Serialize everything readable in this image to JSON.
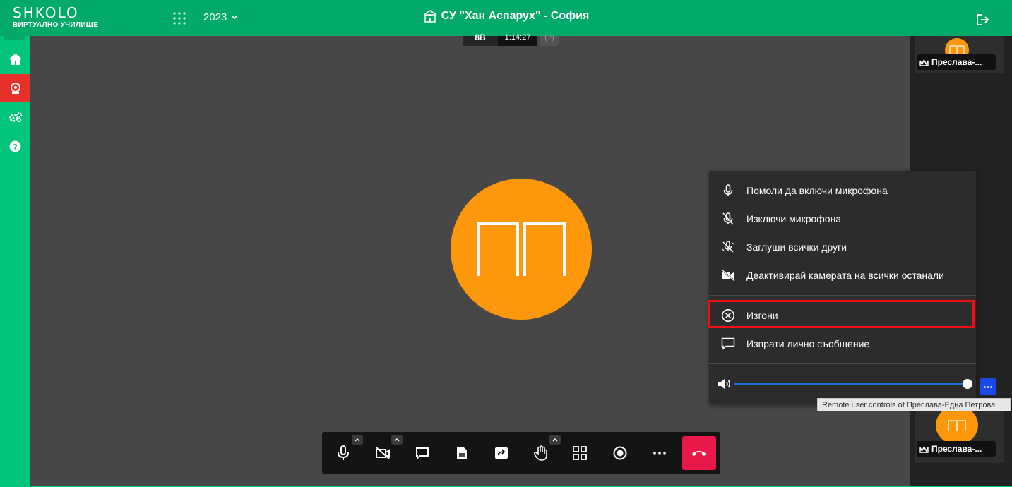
{
  "app": {
    "logo_word": "SHKOLO",
    "logo_sub": "ВИРТУАЛНО УЧИЛИЩЕ",
    "year": "2023",
    "school_name": "СУ \"Хан Аспарух\" - София"
  },
  "session": {
    "class_label": "8В",
    "timer": "1:14:27",
    "help_label": "(?)"
  },
  "main_avatar": {
    "initials": "ПП",
    "color": "#fd980d"
  },
  "participants": [
    {
      "name": "Преслава-...",
      "initials": "ПП"
    },
    {
      "name": "Преслава-...",
      "initials": "ПП"
    }
  ],
  "context_menu": {
    "items": [
      {
        "label": "Помоли да включи микрофона",
        "icon": "mic-icon"
      },
      {
        "label": "Изключи микрофона",
        "icon": "mic-off-icon"
      },
      {
        "label": "Заглуши всички други",
        "icon": "mute-all-icon"
      },
      {
        "label": "Деактивирай камерата на всички останали",
        "icon": "camera-off-all-icon"
      }
    ],
    "kick_label": "Изгони",
    "message_label": "Изпрати лично съобщение",
    "volume_percent": 100
  },
  "tooltip": "Remote user controls of Преслава-Една Петрова",
  "colors": {
    "brand_green": "#02a968",
    "sidebar_green": "#02c47b",
    "active_red": "#e8302b",
    "hangup": "#e8194a",
    "accent_blue": "#1f6ee2",
    "highlight_red": "#ef0f12"
  }
}
